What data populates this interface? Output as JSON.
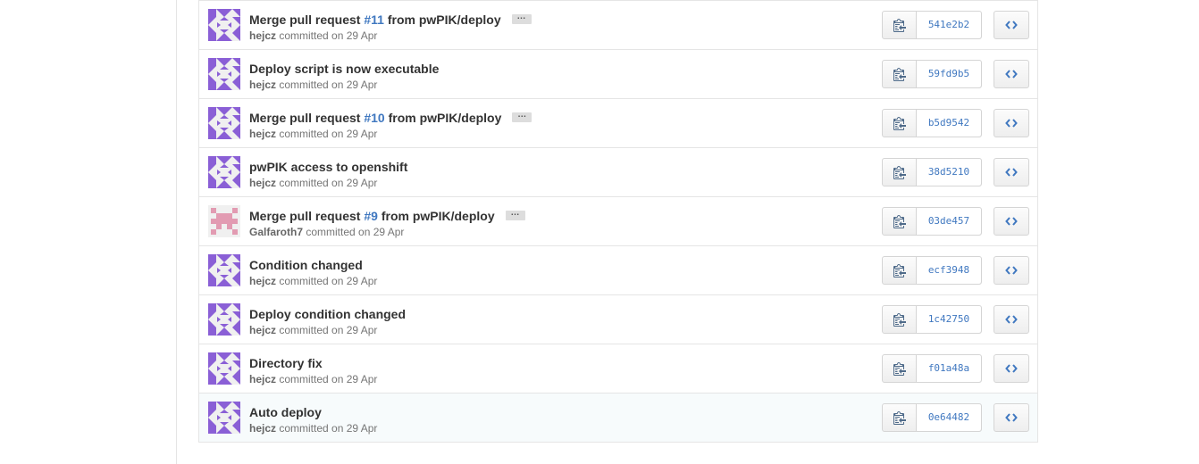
{
  "colors": {
    "link": "#4078c0",
    "border": "#e5e5e5",
    "avatar_purple": "#8a5fd6",
    "avatar_pink": "#e29bb2",
    "row_highlight": "#f7fbfc"
  },
  "icons": {
    "copy": "clippy-icon",
    "browse": "code-icon",
    "more": "ellipsis-icon"
  },
  "commits": [
    {
      "title_before": "Merge pull request ",
      "pr": "#11",
      "title_after": " from pwPIK/deploy",
      "has_ellipsis": true,
      "author": "hejcz",
      "meta": " committed on 29 Apr",
      "sha": "541e2b2",
      "avatar": "purple",
      "highlight": false
    },
    {
      "title_before": "Deploy script is now executable",
      "pr": "",
      "title_after": "",
      "has_ellipsis": false,
      "author": "hejcz",
      "meta": " committed on 29 Apr",
      "sha": "59fd9b5",
      "avatar": "purple",
      "highlight": false
    },
    {
      "title_before": "Merge pull request ",
      "pr": "#10",
      "title_after": " from pwPIK/deploy",
      "has_ellipsis": true,
      "author": "hejcz",
      "meta": " committed on 29 Apr",
      "sha": "b5d9542",
      "avatar": "purple",
      "highlight": false
    },
    {
      "title_before": "pwPIK access to openshift",
      "pr": "",
      "title_after": "",
      "has_ellipsis": false,
      "author": "hejcz",
      "meta": " committed on 29 Apr",
      "sha": "38d5210",
      "avatar": "purple",
      "highlight": false
    },
    {
      "title_before": "Merge pull request ",
      "pr": "#9",
      "title_after": " from pwPIK/deploy",
      "has_ellipsis": true,
      "author": "Galfaroth7",
      "meta": " committed on 29 Apr",
      "sha": "03de457",
      "avatar": "pink",
      "highlight": false
    },
    {
      "title_before": "Condition changed",
      "pr": "",
      "title_after": "",
      "has_ellipsis": false,
      "author": "hejcz",
      "meta": " committed on 29 Apr",
      "sha": "ecf3948",
      "avatar": "purple",
      "highlight": false
    },
    {
      "title_before": "Deploy condition changed",
      "pr": "",
      "title_after": "",
      "has_ellipsis": false,
      "author": "hejcz",
      "meta": " committed on 29 Apr",
      "sha": "1c42750",
      "avatar": "purple",
      "highlight": false
    },
    {
      "title_before": "Directory fix",
      "pr": "",
      "title_after": "",
      "has_ellipsis": false,
      "author": "hejcz",
      "meta": " committed on 29 Apr",
      "sha": "f01a48a",
      "avatar": "purple",
      "highlight": false
    },
    {
      "title_before": "Auto deploy",
      "pr": "",
      "title_after": "",
      "has_ellipsis": false,
      "author": "hejcz",
      "meta": " committed on 29 Apr",
      "sha": "0e64482",
      "avatar": "purple",
      "highlight": true
    }
  ]
}
